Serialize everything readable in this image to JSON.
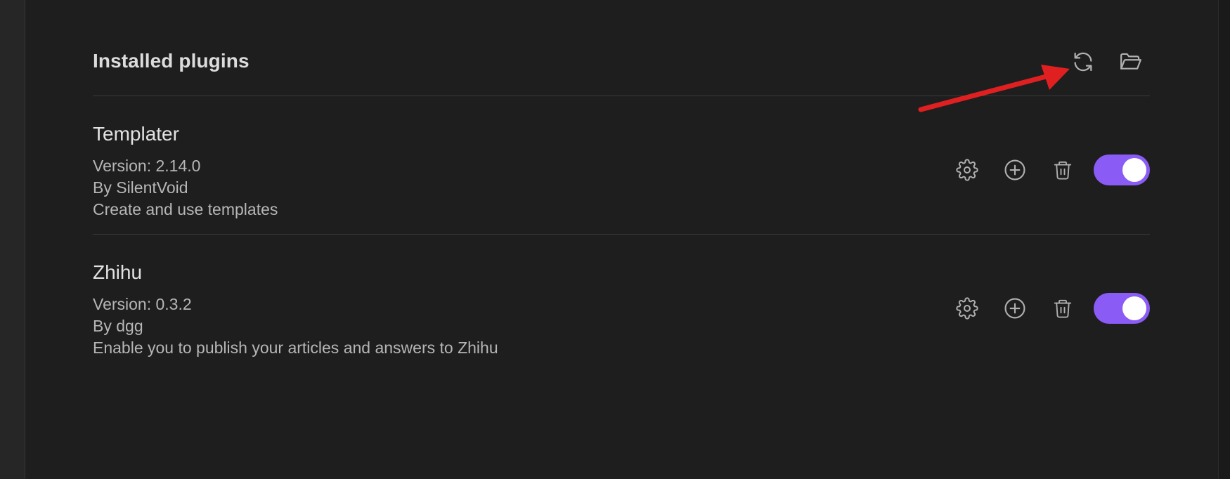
{
  "header": {
    "title": "Installed plugins",
    "reload_icon": "reload-icon",
    "folder_icon": "folder-open-icon"
  },
  "plugins": [
    {
      "name": "Templater",
      "version": "Version: 2.14.0",
      "author": "By SilentVoid",
      "description": "Create and use templates",
      "enabled": true
    },
    {
      "name": "Zhihu",
      "version": "Version: 0.3.2",
      "author": "By dgg",
      "description": "Enable you to publish your articles and answers to Zhihu",
      "enabled": true
    }
  ],
  "row_icons": [
    "gear-icon",
    "plus-circle-icon",
    "trash-icon"
  ],
  "colors": {
    "background": "#1e1e1e",
    "accent": "#8a5cf5",
    "annotation_arrow": "#e02020"
  }
}
